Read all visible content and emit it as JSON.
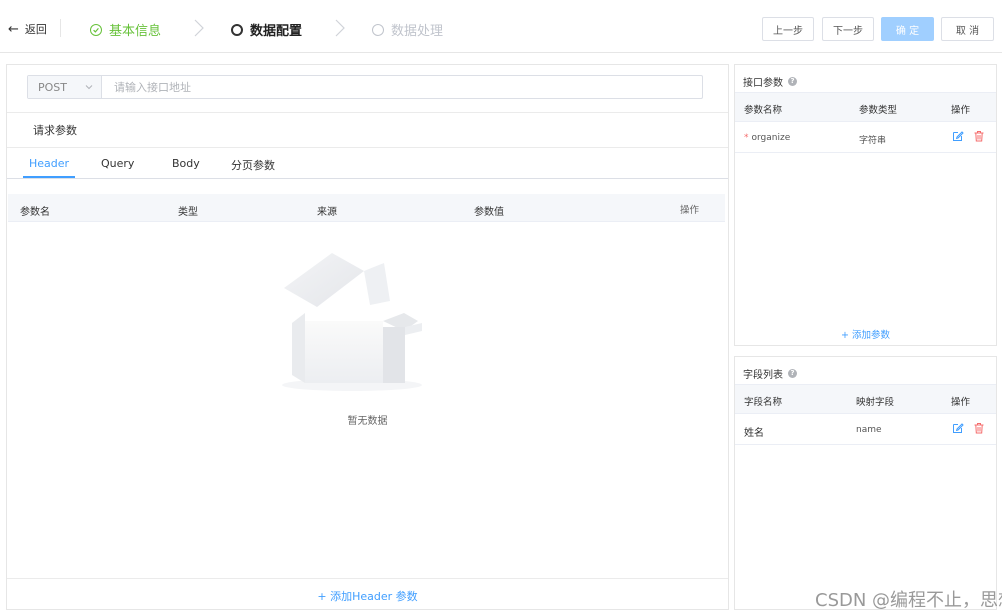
{
  "topbar": {
    "back_label": "返回",
    "steps": [
      {
        "label": "基本信息",
        "status": "done"
      },
      {
        "label": "数据配置",
        "status": "active"
      },
      {
        "label": "数据处理",
        "status": "pending"
      }
    ],
    "buttons": {
      "prev": "上一步",
      "next": "下一步",
      "confirm": "确 定",
      "cancel": "取 消"
    }
  },
  "request": {
    "method": "POST",
    "url_value": "",
    "url_placeholder": "请输入接口地址",
    "section_title": "请求参数",
    "tabs": [
      "Header",
      "Query",
      "Body",
      "分页参数"
    ],
    "active_tab": "Header",
    "table_headers": [
      "参数名",
      "类型",
      "来源",
      "参数值",
      "操作"
    ],
    "empty_text": "暂无数据",
    "add_button": "+ 添加Header 参数"
  },
  "interface_params": {
    "title": "接口参数",
    "headers": [
      "参数名称",
      "参数类型",
      "操作"
    ],
    "rows": [
      {
        "required_mark": "*",
        "name": "organize",
        "type": "字符串"
      }
    ],
    "add_button": "+ 添加参数"
  },
  "field_list": {
    "title": "字段列表",
    "headers": [
      "字段名称",
      "映射字段",
      "操作"
    ],
    "rows": [
      {
        "name": "姓名",
        "mapping": "name"
      }
    ]
  },
  "watermark": "CSDN @编程不止，思想不息",
  "colors": {
    "primary": "#409eff",
    "success": "#67c23a",
    "danger": "#f56c6c",
    "disabled_button": "#a0cfff"
  }
}
